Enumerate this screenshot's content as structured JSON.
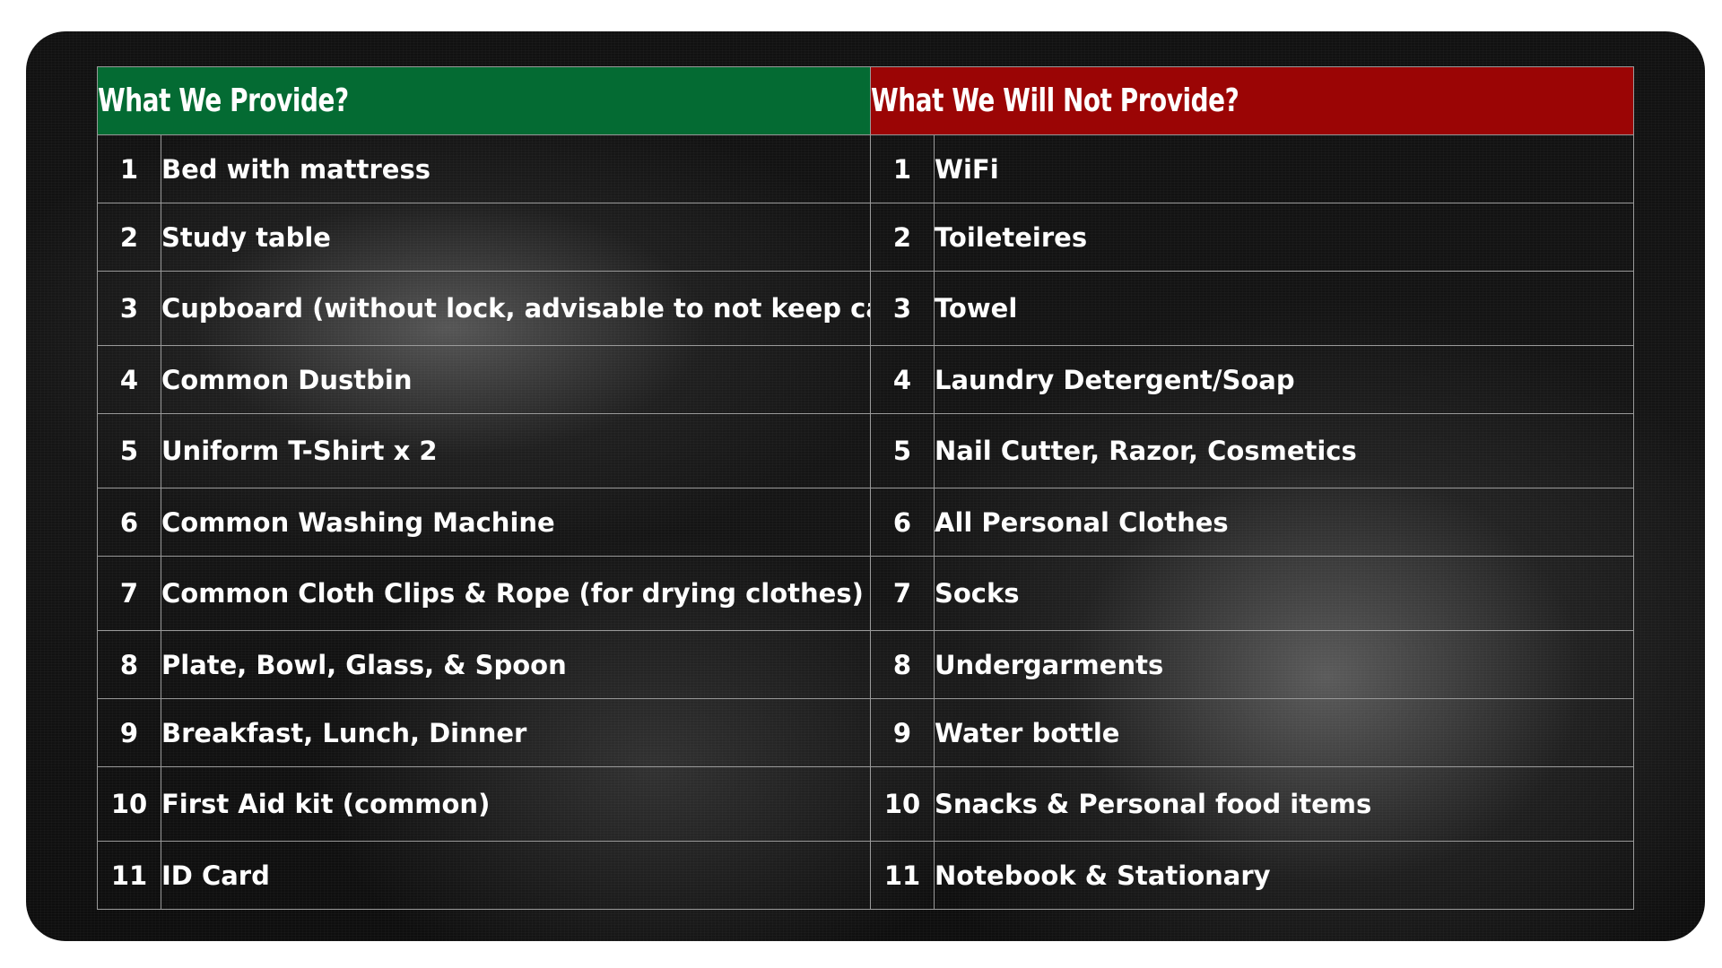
{
  "provide": {
    "title": "What We Provide?",
    "items": [
      {
        "num": "1",
        "text": "Bed with mattress"
      },
      {
        "num": "2",
        "text": "Study table"
      },
      {
        "num": "3",
        "text": "Cupboard (without lock, advisable to not keep cash)"
      },
      {
        "num": "4",
        "text": "Common Dustbin"
      },
      {
        "num": "5",
        "text": "Uniform T-Shirt x 2"
      },
      {
        "num": "6",
        "text": "Common Washing Machine"
      },
      {
        "num": "7",
        "text": "Common Cloth Clips & Rope (for drying clothes)"
      },
      {
        "num": "8",
        "text": "Plate, Bowl, Glass, & Spoon"
      },
      {
        "num": "9",
        "text": "Breakfast, Lunch, Dinner"
      },
      {
        "num": "10",
        "text": "First Aid kit (common)"
      },
      {
        "num": "11",
        "text": "ID Card"
      }
    ]
  },
  "not_provide": {
    "title": "What We Will Not Provide?",
    "items": [
      {
        "num": "1",
        "text": "WiFi"
      },
      {
        "num": "2",
        "text": "Toileteires"
      },
      {
        "num": "3",
        "text": "Towel"
      },
      {
        "num": "4",
        "text": "Laundry Detergent/Soap"
      },
      {
        "num": "5",
        "text": "Nail Cutter, Razor, Cosmetics"
      },
      {
        "num": "6",
        "text": "All Personal Clothes"
      },
      {
        "num": "7",
        "text": "Socks"
      },
      {
        "num": "8",
        "text": "Undergarments"
      },
      {
        "num": "9",
        "text": "Water bottle"
      },
      {
        "num": "10",
        "text": "Snacks & Personal food items"
      },
      {
        "num": "11",
        "text": "Notebook & Stationary"
      }
    ]
  },
  "colors": {
    "provide_header": "#046b33",
    "not_provide_header": "#9b0505",
    "background": "#111111",
    "border": "#9a9a9a",
    "text": "#ffffff"
  }
}
